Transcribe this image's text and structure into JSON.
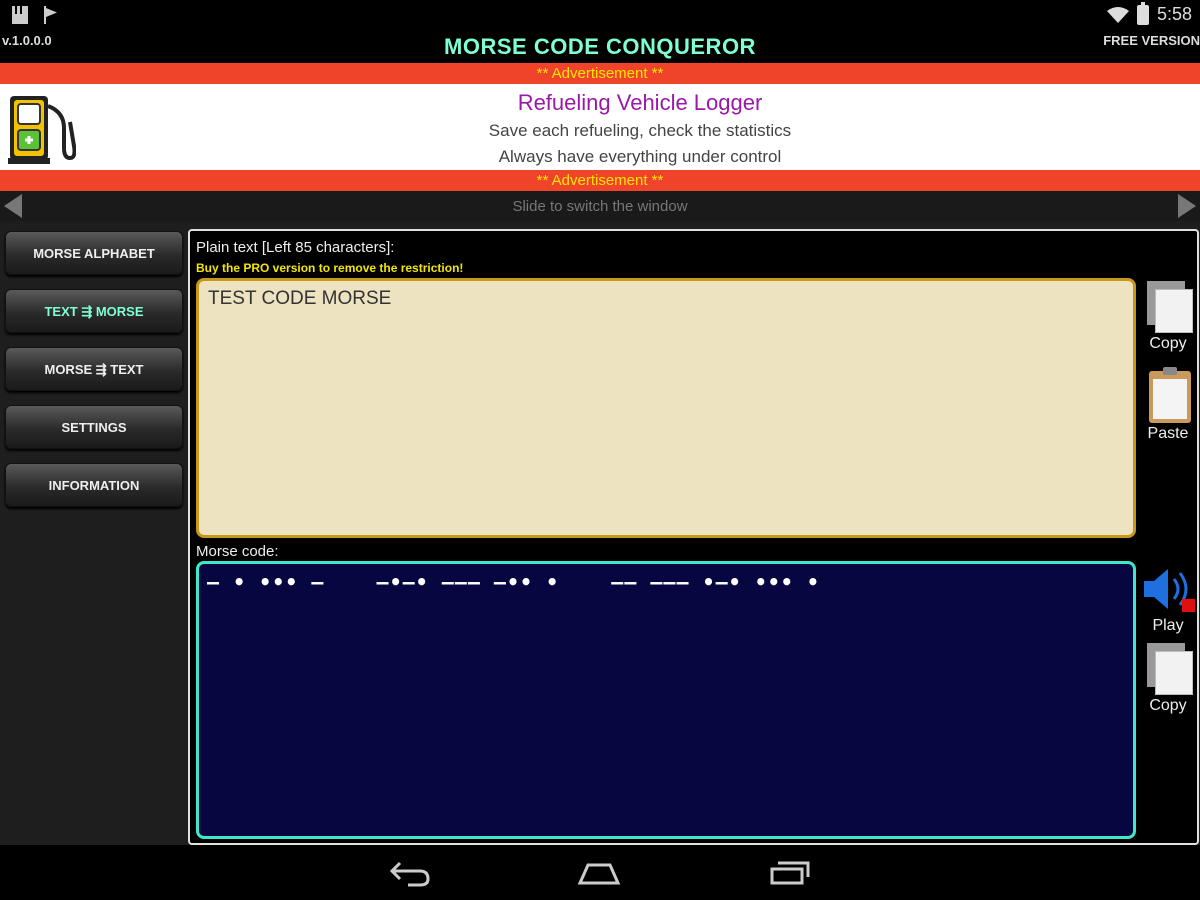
{
  "status_bar": {
    "time": "5:58"
  },
  "header": {
    "version": "v.1.0.0.0",
    "title": "MORSE CODE CONQUEROR",
    "edition": "FREE VERSION"
  },
  "advertisement": {
    "banner_label": "** Advertisement **",
    "title": "Refueling Vehicle Logger",
    "line1": "Save each refueling, check the statistics",
    "line2": "Always have everything under control"
  },
  "slide_hint": "Slide to switch the window",
  "menu": {
    "items": [
      {
        "label": "MORSE ALPHABET"
      },
      {
        "label": "TEXT ⇶ MORSE"
      },
      {
        "label": "MORSE ⇶ TEXT"
      },
      {
        "label": "SETTINGS"
      },
      {
        "label": "INFORMATION"
      }
    ],
    "active_index": 1
  },
  "editor": {
    "plain_label": "Plain text [Left 85 characters]:",
    "pro_note": "Buy the PRO version to remove the restriction!",
    "plain_value": "TEST CODE MORSE",
    "morse_label": "Morse code:",
    "morse_value": "– • ••• –    –•–• ––– –•• •    –– ––– •–• ••• •"
  },
  "actions": {
    "copy_plain": "Copy",
    "paste": "Paste",
    "play": "Play",
    "copy_morse": "Copy"
  },
  "icons": [
    "sd-card-icon",
    "flag-icon",
    "wifi-icon",
    "battery-icon",
    "fuel-pump-icon",
    "arrow-left-icon",
    "arrow-right-icon",
    "copy-icon",
    "paste-icon",
    "speaker-icon",
    "back-icon",
    "home-icon",
    "recent-apps-icon"
  ],
  "colors": {
    "title": "#7fffd4",
    "ad_strip": "#f0442a",
    "ad_strip_text": "#ffe600",
    "ad_title": "#9a19a8",
    "plain_box": "#ede3c0",
    "plain_border": "#c8961a",
    "morse_box": "#060640",
    "morse_border": "#3ee8c8",
    "pro_note": "#f2e600"
  }
}
